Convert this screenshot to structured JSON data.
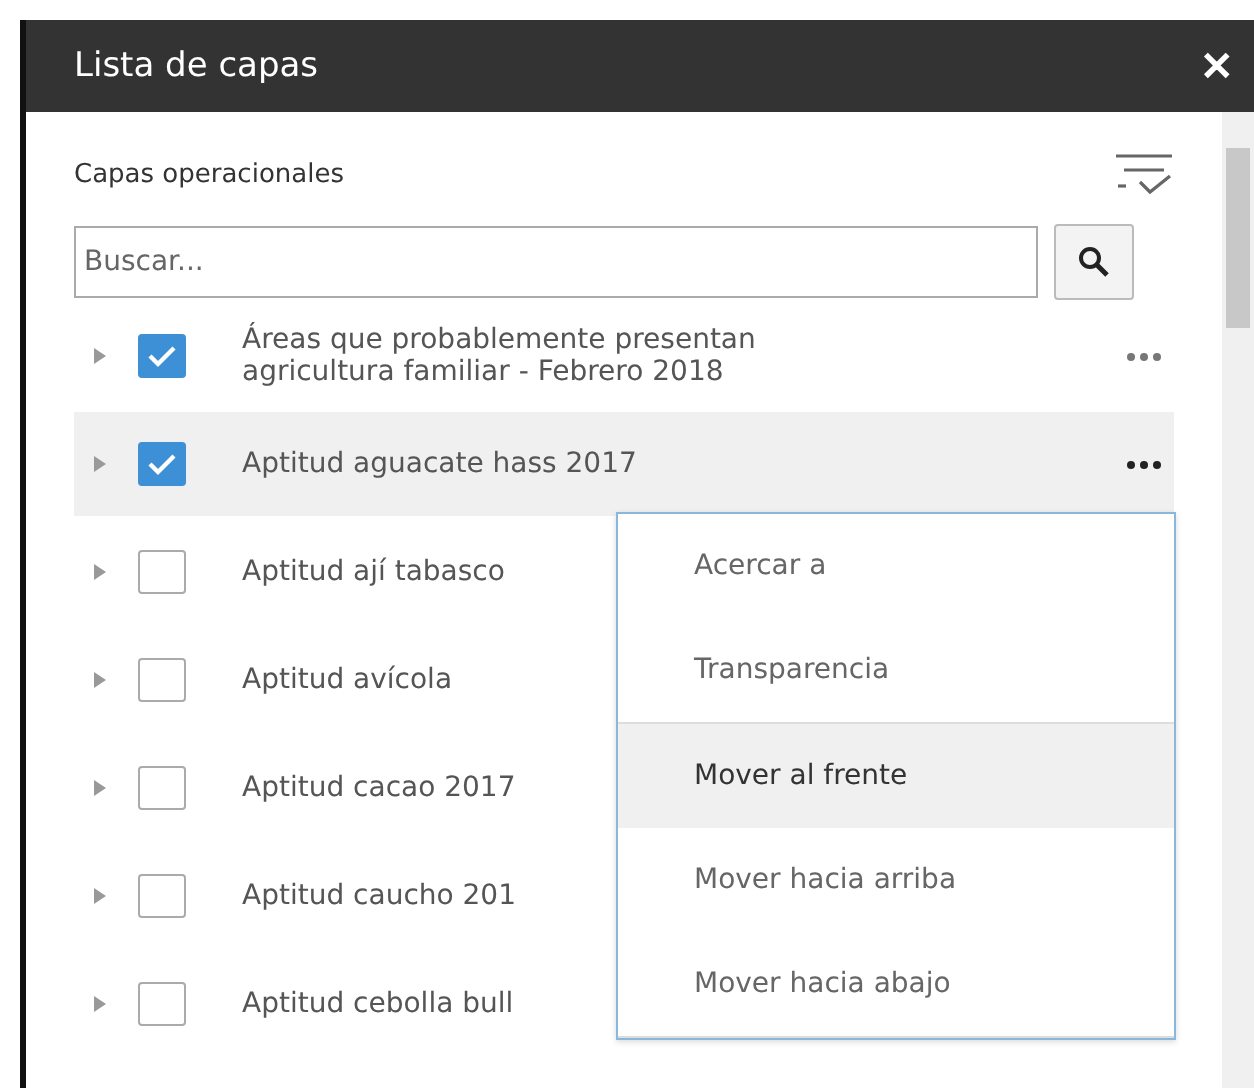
{
  "window": {
    "title": "Lista de capas",
    "close": "✕"
  },
  "section": {
    "title": "Capas operacionales"
  },
  "search": {
    "placeholder": "Buscar..."
  },
  "layers": [
    {
      "name": "Áreas que probablemente presentan agricultura familiar - Febrero 2018",
      "checked": true,
      "selected": false,
      "menu": true
    },
    {
      "name": "Aptitud aguacate hass 2017",
      "checked": true,
      "selected": true,
      "menu": true
    },
    {
      "name": "Aptitud ají tabasco",
      "checked": false,
      "selected": false
    },
    {
      "name": "Aptitud avícola",
      "checked": false,
      "selected": false
    },
    {
      "name": "Aptitud cacao 2017",
      "checked": false,
      "selected": false
    },
    {
      "name": "Aptitud caucho 201",
      "checked": false,
      "selected": false
    },
    {
      "name": "Aptitud cebolla bull",
      "checked": false,
      "selected": false
    }
  ],
  "context_menu": {
    "items": [
      {
        "label": "Acercar a",
        "selected": false,
        "divider_after": false
      },
      {
        "label": "Transparencia",
        "selected": false,
        "divider_after": true
      },
      {
        "label": "Mover al frente",
        "selected": true,
        "divider_after": false
      },
      {
        "label": "Mover hacia arriba",
        "selected": false,
        "divider_after": false
      },
      {
        "label": "Mover hacia abajo",
        "selected": false,
        "divider_after": true
      }
    ]
  }
}
